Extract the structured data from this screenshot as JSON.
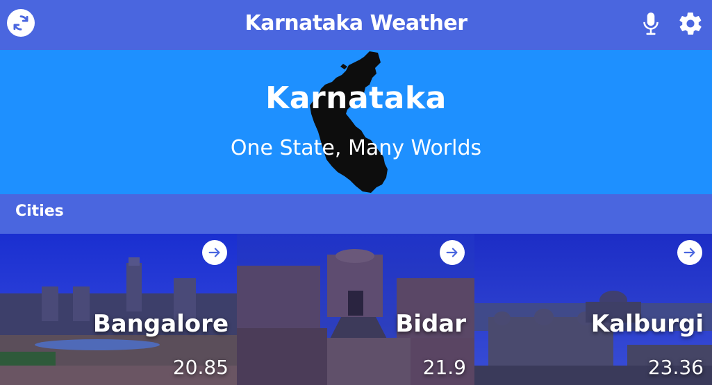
{
  "app": {
    "title": "Karnataka Weather"
  },
  "hero": {
    "title": "Karnataka",
    "subtitle": "One State, Many Worlds"
  },
  "section": {
    "label": "Cities"
  },
  "cities": [
    {
      "name": "Bangalore",
      "temp": "20.85"
    },
    {
      "name": "Bidar",
      "temp": "21.9"
    },
    {
      "name": "Kalburgi",
      "temp": "23.36"
    }
  ],
  "icons": {
    "refresh": "refresh-icon",
    "mic": "microphone-icon",
    "settings": "gear-icon",
    "arrow": "arrow-right-icon"
  },
  "colors": {
    "header": "#4a66df",
    "hero": "#1e90ff",
    "text": "#ffffff"
  }
}
